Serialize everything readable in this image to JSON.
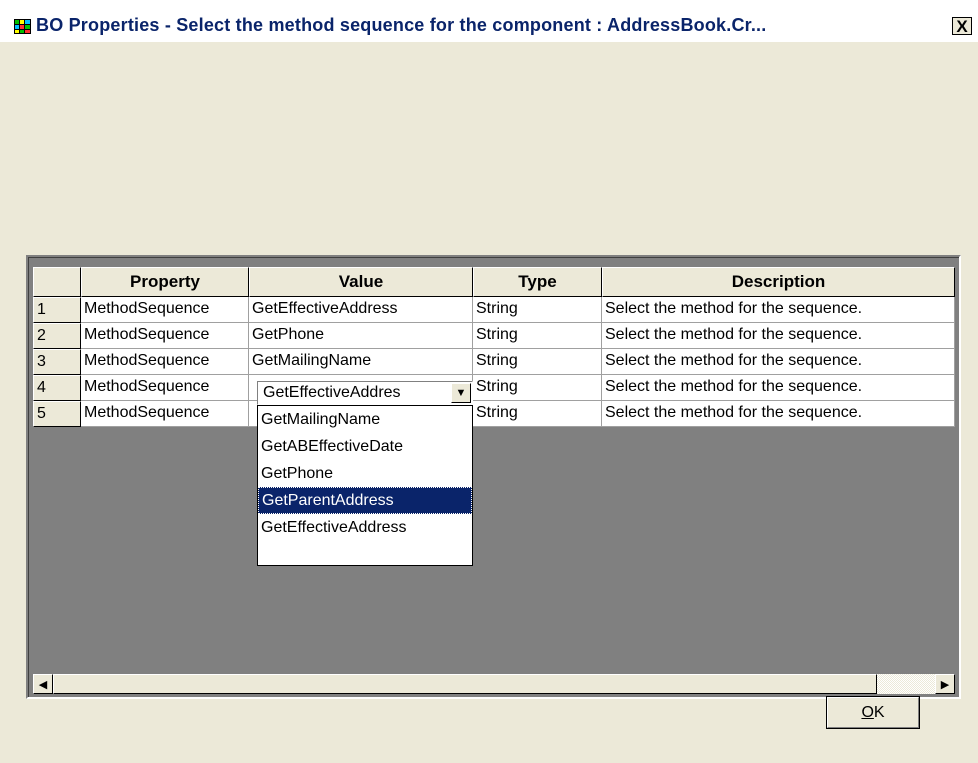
{
  "window": {
    "title": "BO Properties - Select the method sequence for the component : AddressBook.Cr...",
    "close_label": "X"
  },
  "grid": {
    "columns": [
      "Property",
      "Value",
      "Type",
      "Description"
    ],
    "rows": [
      {
        "num": "1",
        "property": "MethodSequence",
        "value": "GetEffectiveAddress",
        "type": "String",
        "description": "Select the method for the sequence."
      },
      {
        "num": "2",
        "property": "MethodSequence",
        "value": "GetPhone",
        "type": "String",
        "description": "Select the method for the sequence."
      },
      {
        "num": "3",
        "property": "MethodSequence",
        "value": "GetMailingName",
        "type": "String",
        "description": "Select the method for the sequence."
      },
      {
        "num": "4",
        "property": "MethodSequence",
        "value": "",
        "type": "String",
        "description": "Select the method for the sequence."
      },
      {
        "num": "5",
        "property": "MethodSequence",
        "value": "",
        "type": "String",
        "description": "Select the method for the sequence."
      }
    ]
  },
  "combo": {
    "value": "GetEffectiveAddres",
    "options": [
      "GetMailingName",
      "GetABEffectiveDate",
      "GetPhone",
      "GetParentAddress",
      "GetEffectiveAddress"
    ],
    "highlighted": "GetParentAddress"
  },
  "buttons": {
    "ok_label": "K",
    "ok_mnemonic": "O"
  },
  "colors": {
    "title_text": "#0a246a",
    "selection": "#0a246a",
    "face": "#ece9d8",
    "grid_bg": "#808080"
  }
}
